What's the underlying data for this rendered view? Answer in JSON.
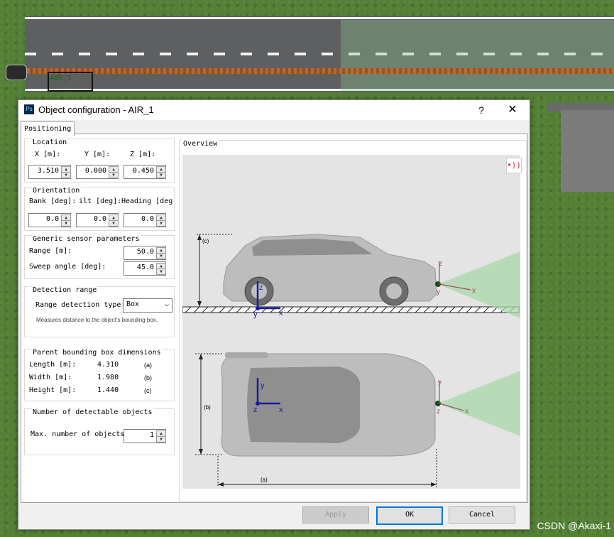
{
  "background": {
    "object_label": "AIR_1",
    "watermark": "CSDN @Akaxi-1"
  },
  "dialog": {
    "title": "Object configuration - AIR_1",
    "help_glyph": "?",
    "close_glyph": "✕",
    "app_icon_text": "Ps",
    "tab_positioning": "Positioning",
    "location": {
      "title": "Location",
      "x_label": "X  [m]:",
      "y_label": "Y [m]:",
      "z_label": "Z [m]:",
      "x_value": "3.510",
      "y_value": "0.000",
      "z_value": "0.450"
    },
    "orientation": {
      "title": "Orientation",
      "bank_label": "Bank [deg]:",
      "tilt_label": "ilt [deg]:",
      "heading_label": "Heading [deg",
      "bank_value": "0.0",
      "tilt_value": "0.0",
      "heading_value": "0.0"
    },
    "generic": {
      "title": "Generic sensor parameters",
      "range_label": "Range  [m]:",
      "range_value": "50.0",
      "sweep_label": "Sweep angle [deg]:",
      "sweep_value": "45.0"
    },
    "detection": {
      "title": "Detection range",
      "type_label": "Range detection type:",
      "type_value": "Box",
      "note": "Measures distance to the object's bounding box."
    },
    "parent_bbox": {
      "title": "Parent bounding box dimensions",
      "length_label": "Length [m]:",
      "length_value": "4.310",
      "length_ref": "(a)",
      "width_label": "Width [m]:",
      "width_value": "1.980",
      "width_ref": "(b)",
      "height_label": "Height [m]:",
      "height_value": "1.440",
      "height_ref": "(c)"
    },
    "detectable": {
      "title": "Number of detectable objects",
      "max_label": "Max. number of objects",
      "max_value": "1"
    },
    "overview": {
      "title": "Overview",
      "dim_a": "(a)",
      "dim_b": "(b)",
      "dim_c": "(c)",
      "axis_x": "x",
      "axis_y": "y",
      "axis_z": "z"
    },
    "buttons": {
      "apply": "Apply",
      "ok": "OK",
      "cancel": "Cancel"
    },
    "colors": {
      "sensor_beam": "#a8d8a8",
      "axis_blue": "#1a1aa0",
      "axis_red": "#a05050",
      "accent": "#0078d7"
    }
  }
}
